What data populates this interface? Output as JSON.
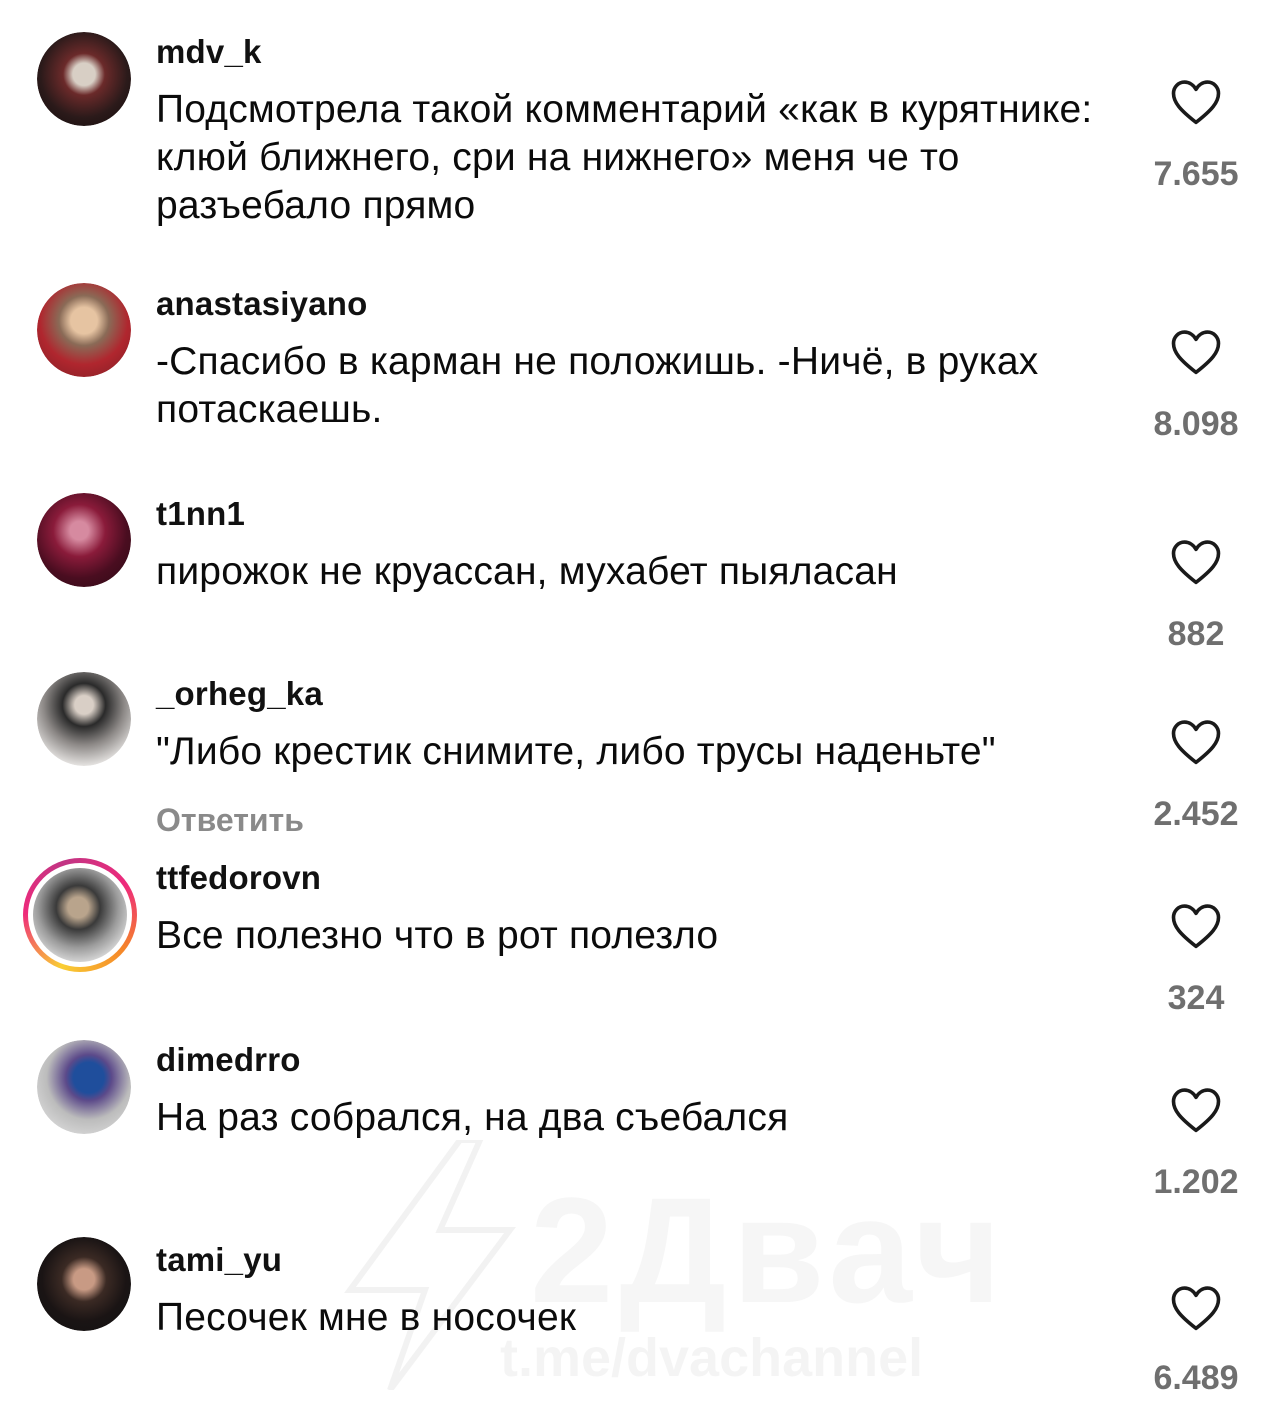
{
  "comments": [
    {
      "username": "mdv_k",
      "text": "Подсмотрела такой комментарий «как в курятнике: клюй ближнего, сри на нижнего» меня че то разъебало прямо",
      "likes": "7.655",
      "avatar_colors": [
        "#2b1a1a",
        "#6b2a2a",
        "#c9c2b8"
      ]
    },
    {
      "username": "anastasiyano",
      "text": "-Спасибо в карман не положишь. -Ничё, в руках потаскаешь.",
      "likes": "8.098",
      "avatar_colors": [
        "#7a1f25",
        "#c8a47f",
        "#b0262e"
      ]
    },
    {
      "username": "t1nn1",
      "text": "пирожок не круассан, мухабет пыяласан",
      "likes": "882",
      "avatar_colors": [
        "#2a0b14",
        "#8a1b3a",
        "#d68aa0"
      ]
    },
    {
      "username": "_orheg_ka",
      "text": "\"Либо крестик снимите, либо трусы наденьте\"",
      "likes": "2.452",
      "reply_label": "Ответить",
      "avatar_colors": [
        "#e8e6e4",
        "#2a2a2a",
        "#d9cfc6"
      ]
    },
    {
      "username": "ttfedorovn",
      "text": "Все полезно что в рот полезло",
      "likes": "324",
      "avatar_colors": [
        "#f2f2f2",
        "#3a3a3a",
        "#b9a48c"
      ]
    },
    {
      "username": "dimedrro",
      "text": "На раз собрался, на два съебался",
      "likes": "1.202",
      "avatar_colors": [
        "#dcdcdc",
        "#1f4e9c",
        "#5c4a8a"
      ]
    },
    {
      "username": "tami_yu",
      "text": "Песочек мне в носочек",
      "likes": "6.489",
      "avatar_colors": [
        "#111111",
        "#3b2a24",
        "#c89a84"
      ]
    }
  ],
  "icons": {
    "like": "heart-outline-icon"
  },
  "watermark": {
    "logo": "2Двач",
    "url": "t.me/dvachannel"
  }
}
